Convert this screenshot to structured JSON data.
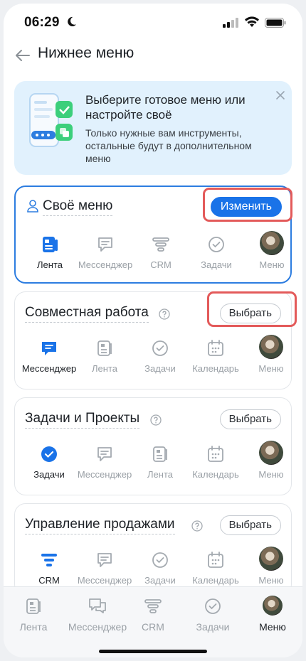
{
  "status": {
    "time": "06:29"
  },
  "header": {
    "title": "Нижнее меню"
  },
  "promo": {
    "title": "Выберите готовое меню или настройте своё",
    "subtitle": "Только нужные вам инструменты, остальные будут в дополнительном меню"
  },
  "cards": [
    {
      "title": "Своё меню",
      "button": "Изменить",
      "items": [
        {
          "label": "Лента",
          "icon": "feed-icon"
        },
        {
          "label": "Мессенджер",
          "icon": "messenger-icon"
        },
        {
          "label": "CRM",
          "icon": "crm-icon"
        },
        {
          "label": "Задачи",
          "icon": "tasks-icon"
        },
        {
          "label": "Меню",
          "icon": "avatar"
        }
      ]
    },
    {
      "title": "Совместная работа",
      "button": "Выбрать",
      "items": [
        {
          "label": "Мессенджер",
          "icon": "messenger-icon"
        },
        {
          "label": "Лента",
          "icon": "feed-icon"
        },
        {
          "label": "Задачи",
          "icon": "tasks-icon"
        },
        {
          "label": "Календарь",
          "icon": "calendar-icon"
        },
        {
          "label": "Меню",
          "icon": "avatar"
        }
      ]
    },
    {
      "title": "Задачи и Проекты",
      "button": "Выбрать",
      "items": [
        {
          "label": "Задачи",
          "icon": "tasks-icon"
        },
        {
          "label": "Мессенджер",
          "icon": "messenger-icon"
        },
        {
          "label": "Лента",
          "icon": "feed-icon"
        },
        {
          "label": "Календарь",
          "icon": "calendar-icon"
        },
        {
          "label": "Меню",
          "icon": "avatar"
        }
      ]
    },
    {
      "title": "Управление продажами",
      "button": "Выбрать",
      "items": [
        {
          "label": "CRM",
          "icon": "crm-icon"
        },
        {
          "label": "Мессенджер",
          "icon": "messenger-icon"
        },
        {
          "label": "Задачи",
          "icon": "tasks-icon"
        },
        {
          "label": "Календарь",
          "icon": "calendar-icon"
        },
        {
          "label": "Меню",
          "icon": "avatar"
        }
      ]
    }
  ],
  "tabbar": [
    {
      "label": "Лента",
      "icon": "feed-icon"
    },
    {
      "label": "Мессенджер",
      "icon": "messenger-icon"
    },
    {
      "label": "CRM",
      "icon": "crm-icon"
    },
    {
      "label": "Задачи",
      "icon": "tasks-icon"
    },
    {
      "label": "Меню",
      "icon": "avatar"
    }
  ],
  "colors": {
    "accent": "#1a73e8",
    "highlight": "#e35a5a",
    "promo_bg": "#e1f1fd"
  }
}
